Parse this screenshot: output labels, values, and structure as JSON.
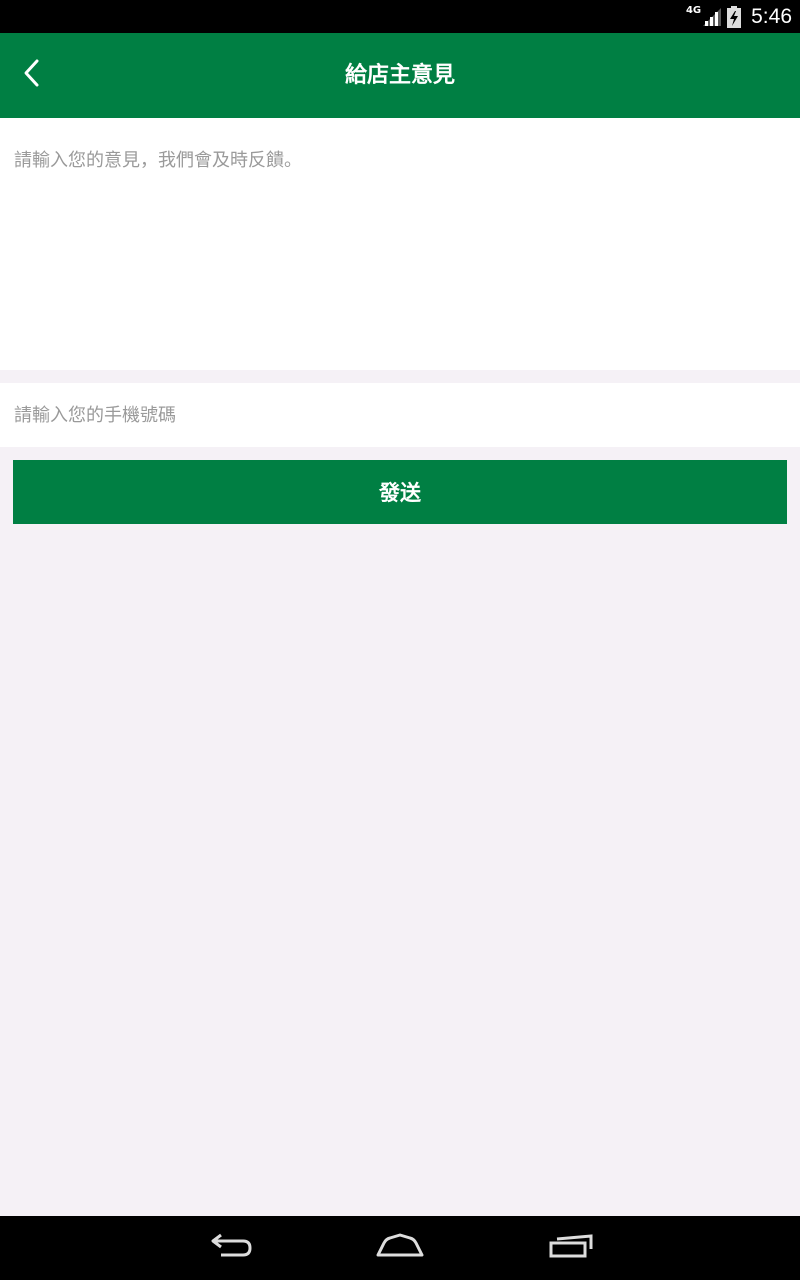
{
  "status_bar": {
    "network_type": "4G",
    "time": "5:46"
  },
  "header": {
    "title": "給店主意見"
  },
  "form": {
    "feedback_placeholder": "請輸入您的意見，我們會及時反饋。",
    "feedback_value": "",
    "phone_placeholder": "請輸入您的手機號碼",
    "phone_value": "",
    "send_label": "發送"
  },
  "colors": {
    "brand_green": "#007f43",
    "page_background": "#f5f1f6",
    "placeholder_gray": "#9a9a9a"
  },
  "icons": {
    "back": "back-arrow-icon",
    "signal": "signal-icon",
    "battery": "battery-charging-icon",
    "nav_back": "nav-back-icon",
    "nav_home": "nav-home-icon",
    "nav_recents": "nav-recents-icon"
  }
}
